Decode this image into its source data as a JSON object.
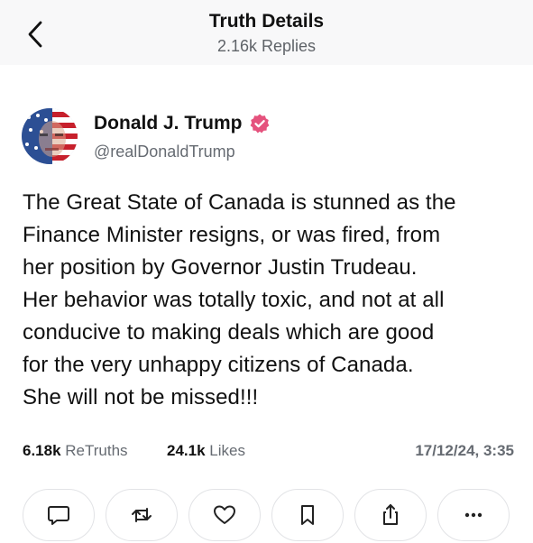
{
  "header": {
    "title": "Truth Details",
    "replies": "2.16k Replies",
    "back_icon": "chevron-left-icon"
  },
  "post": {
    "author": {
      "name": "Donald J. Trump",
      "handle": "@realDonaldTrump",
      "verified": true,
      "verified_color": "#e5527d"
    },
    "text": "The Great State of Canada is stunned as the\nFinance Minister resigns, or was fired, from\nher position by Governor Justin Trudeau.\nHer behavior was totally toxic, and not at all\nconducive to making deals which are good\nfor the very unhappy citizens of Canada.\nShe will not be missed!!!",
    "stats": {
      "retruths_count": "6.18k",
      "retruths_label": "ReTruths",
      "likes_count": "24.1k",
      "likes_label": "Likes",
      "timestamp": "17/12/24, 3:35"
    },
    "actions": [
      {
        "name": "reply",
        "icon": "comment-icon"
      },
      {
        "name": "retruth",
        "icon": "repost-icon"
      },
      {
        "name": "like",
        "icon": "heart-icon"
      },
      {
        "name": "bookmark",
        "icon": "bookmark-icon"
      },
      {
        "name": "share",
        "icon": "share-icon"
      },
      {
        "name": "more",
        "icon": "more-icon"
      }
    ]
  }
}
